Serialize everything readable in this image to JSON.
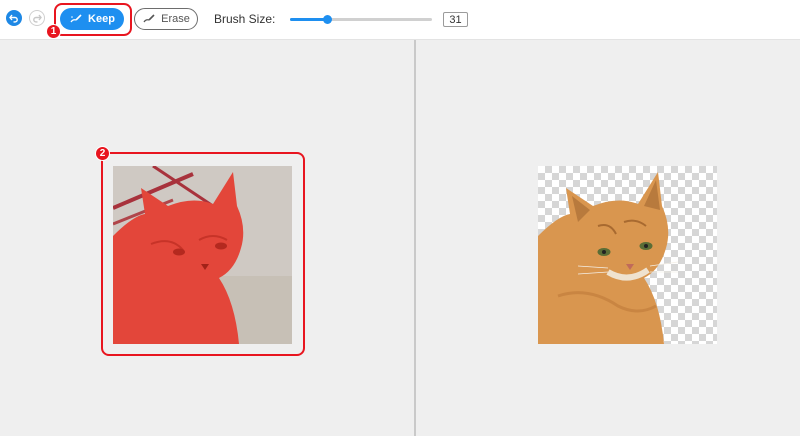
{
  "toolbar": {
    "keep_label": "Keep",
    "erase_label": "Erase",
    "brush_size_label": "Brush Size:",
    "brush_size_value": "31",
    "brush_slider_fraction": 0.26
  },
  "annotations": {
    "badge_1": "1",
    "badge_2": "2"
  },
  "colors": {
    "accent": "#1e8ff0",
    "highlight": "#e8151f",
    "keep_overlay": "#e8453a"
  },
  "icons": {
    "undo": "undo-icon",
    "redo": "redo-icon",
    "keep": "brush-icon",
    "erase": "eraser-icon"
  }
}
